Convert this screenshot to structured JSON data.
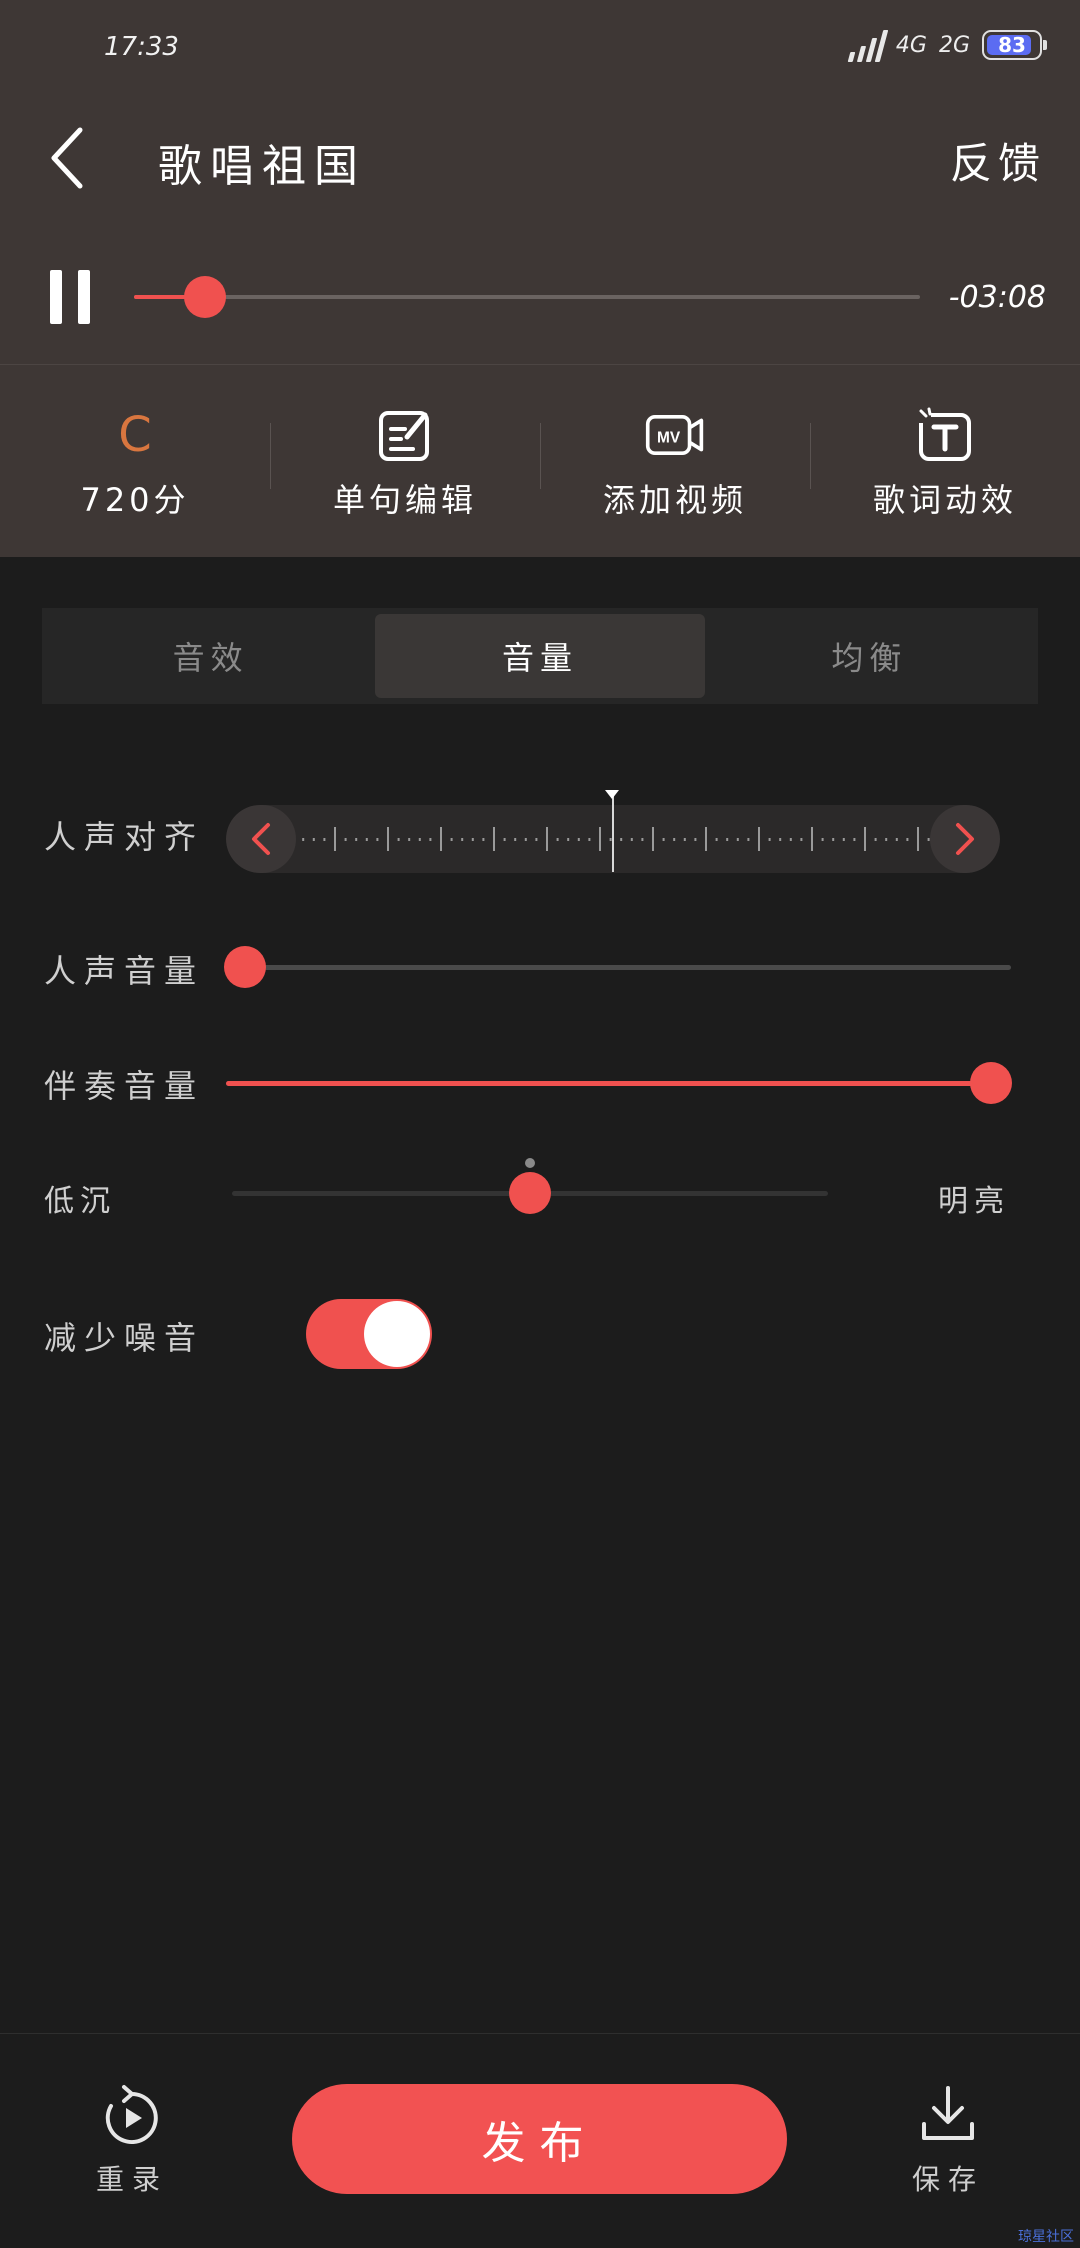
{
  "status_bar": {
    "time": "17:33",
    "network": "4G",
    "network_secondary": "2G",
    "battery": "83"
  },
  "header": {
    "title": "歌唱祖国",
    "feedback_label": "反馈"
  },
  "player": {
    "time_remaining": "-03:08",
    "progress_percent": 9
  },
  "tools": {
    "score": {
      "grade": "C",
      "label": "720分"
    },
    "items": [
      {
        "label": "单句编辑",
        "icon": "edit-icon"
      },
      {
        "label": "添加视频",
        "icon": "mv-camera-icon"
      },
      {
        "label": "歌词动效",
        "icon": "text-effect-icon"
      }
    ]
  },
  "tabs": [
    {
      "label": "音效",
      "active": false
    },
    {
      "label": "音量",
      "active": true
    },
    {
      "label": "均衡",
      "active": false
    }
  ],
  "settings": {
    "vocal_align_label": "人声对齐",
    "vocal_volume_label": "人声音量",
    "vocal_volume_percent": 0,
    "accompaniment_label": "伴奏音量",
    "accompaniment_percent": 100,
    "tone_low_label": "低沉",
    "tone_high_label": "明亮",
    "tone_percent": 50,
    "noise_reduction_label": "减少噪音",
    "noise_reduction_on": true
  },
  "bottom": {
    "rerecord_label": "重录",
    "publish_label": "发布",
    "save_label": "保存"
  },
  "colors": {
    "accent": "#f0514f",
    "top_background": "#3e3735",
    "page_background": "#1c1c1c",
    "grade": "#d9763f",
    "battery": "#5b6cf2"
  },
  "watermark": "琼星社区"
}
